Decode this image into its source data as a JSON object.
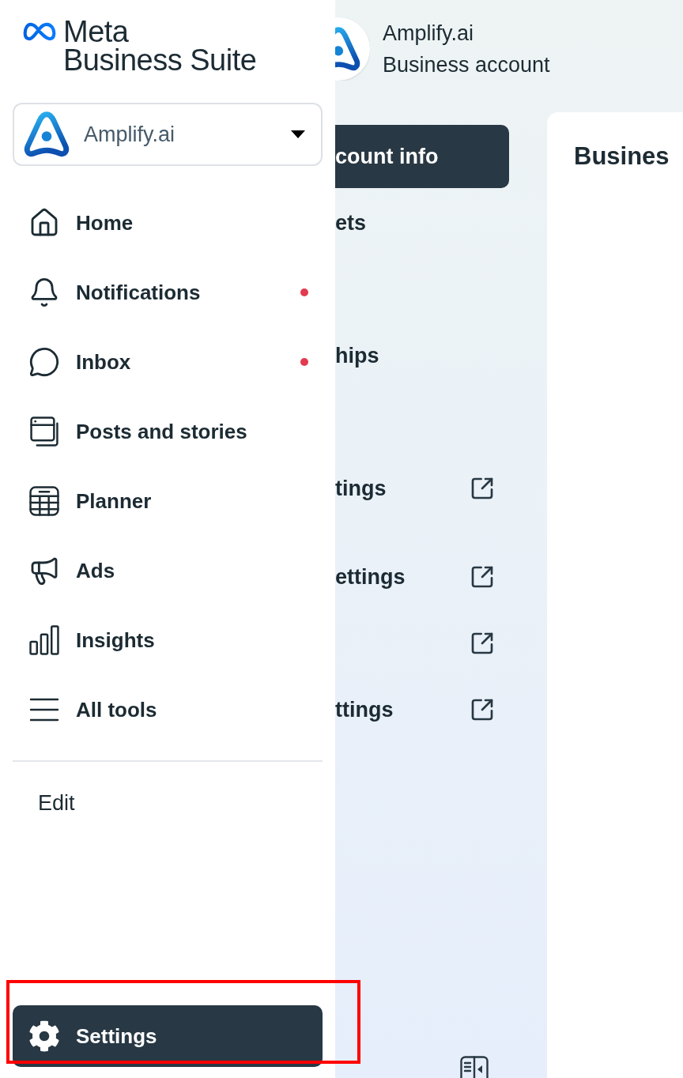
{
  "sidebar": {
    "brand": {
      "line_1": "Meta",
      "line_2": "Business Suite"
    },
    "account_selector": {
      "name": "Amplify.ai"
    },
    "nav_items": [
      {
        "label": "Home",
        "selected": false,
        "unread": false
      },
      {
        "label": "Notifications",
        "selected": false,
        "unread": true
      },
      {
        "label": "Inbox",
        "selected": false,
        "unread": true
      },
      {
        "label": "Posts and stories",
        "selected": false,
        "unread": false
      },
      {
        "label": "Planner",
        "selected": false,
        "unread": false
      },
      {
        "label": "Ads",
        "selected": false,
        "unread": false
      },
      {
        "label": "Insights",
        "selected": false,
        "unread": false
      },
      {
        "label": "All tools",
        "selected": false,
        "unread": false
      }
    ],
    "edit_link": "Edit",
    "settings": {
      "label": "Settings",
      "selected": true,
      "highlighted": true
    }
  },
  "page": {
    "header": {
      "name": "Amplify.ai",
      "subtitle": "Business account"
    },
    "settings_nav": [
      {
        "label": "count info",
        "selected": true,
        "external": false
      },
      {
        "label": "ets",
        "selected": false,
        "external": false
      },
      {
        "label": "hips",
        "selected": false,
        "external": false
      },
      {
        "label": "tings",
        "selected": false,
        "external": true
      },
      {
        "label": "ettings",
        "selected": false,
        "external": true
      },
      {
        "selected": false,
        "external": true
      },
      {
        "label": "ttings",
        "selected": false,
        "external": true
      }
    ],
    "content": {
      "title": "Busines"
    }
  }
}
